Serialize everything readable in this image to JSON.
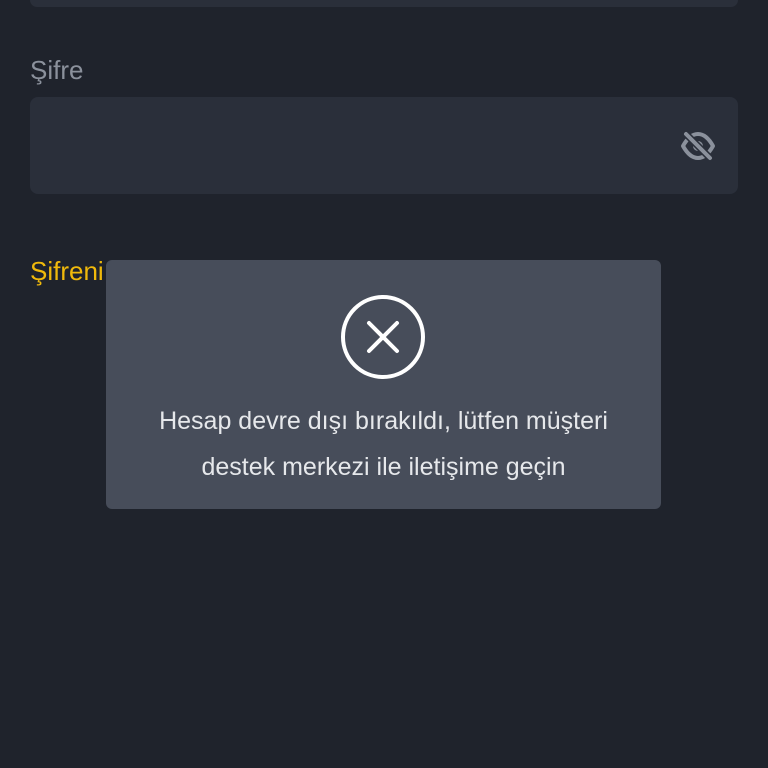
{
  "form": {
    "password_label": "Şifre",
    "password_value": "",
    "forgot_password_text": "Şifreni"
  },
  "icons": {
    "visibility_toggle": "eye-off-icon",
    "toast_icon": "close-circle-icon"
  },
  "toast": {
    "message_line1": "Hesap devre dışı bırakıldı, lütfen müşteri",
    "message_line2": "destek merkezi ile iletişime geçin"
  },
  "colors": {
    "background": "#1f232c",
    "input_background": "#2a2f3a",
    "label": "#8b919c",
    "accent": "#f0b90b",
    "toast_background": "#474d5a",
    "toast_text": "#e6e8eb"
  }
}
